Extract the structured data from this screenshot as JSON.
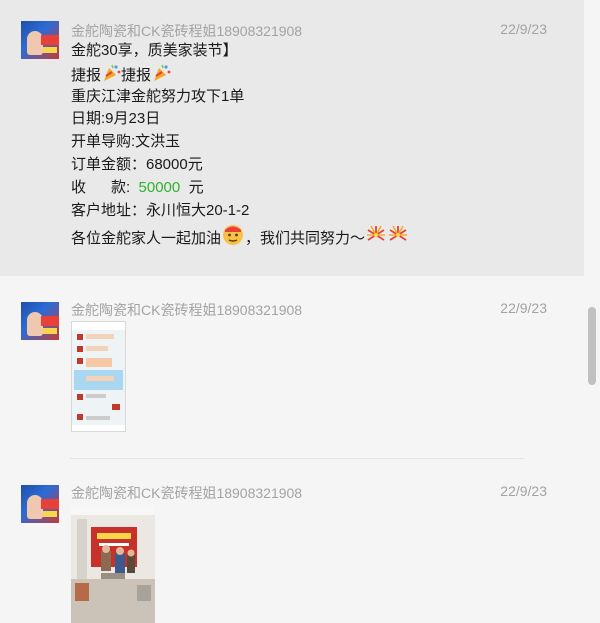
{
  "colors": {
    "accent_green": "#2fb12f",
    "meta_text": "#a3a3a3",
    "highlight_bg": "#e9e9e9"
  },
  "messages": [
    {
      "sender": "金舵陶瓷和CK瓷砖程姐18908321908",
      "time": "22/9/23",
      "lines": {
        "l1": "金舵30享，质美家装节】",
        "l2a": "捷报",
        "l2b": "捷报",
        "l3": "重庆江津金舵努力攻下1单",
        "l4": "日期:9月23日",
        "l5": "开单导购:文洪玉",
        "l6": "订单金额：68000元",
        "l7a": "收      款:  ",
        "l7b": "50000",
        "l7c": "  元",
        "l8": "客户地址：永川恒大20-1-2",
        "l9a": "各位金舵家人一起加油",
        "l9b": "，我们共同努力～"
      },
      "icons": [
        "party-popper-icon",
        "party-popper-icon",
        "money-face-icon",
        "fireworks-icon",
        "fireworks-icon"
      ]
    },
    {
      "sender": "金舵陶瓷和CK瓷砖程姐18908321908",
      "time": "22/9/23",
      "attachment": "chat-screenshot-image"
    },
    {
      "sender": "金舵陶瓷和CK瓷砖程姐18908321908",
      "time": "22/9/23",
      "attachment": "store-photo-image"
    }
  ]
}
